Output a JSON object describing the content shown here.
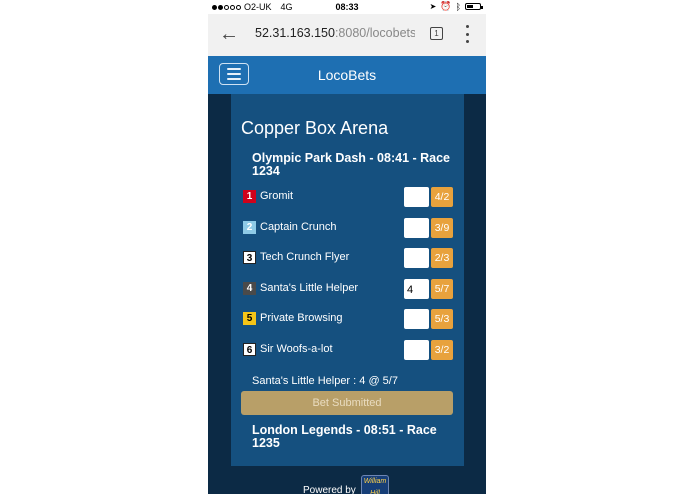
{
  "status_bar": {
    "carrier": "O2-UK",
    "network": "4G",
    "time": "08:33"
  },
  "browser": {
    "url_host": "52.31.163.150",
    "url_rest": ":8080/locobets",
    "tab_count": "1"
  },
  "navbar": {
    "brand": "LocoBets"
  },
  "venue": "Copper Box Arena",
  "races": [
    {
      "title": "Olympic Park Dash - 08:41 - Race 1234",
      "runners": [
        {
          "number": "1",
          "name": "Gromit",
          "stake": "",
          "odds": "4/2",
          "badge_bg": "#d0021b",
          "badge_fg": "#ffffff"
        },
        {
          "number": "2",
          "name": "Captain Crunch",
          "stake": "",
          "odds": "3/9",
          "badge_bg": "#8ecae6",
          "badge_fg": "#ffffff"
        },
        {
          "number": "3",
          "name": "Tech Crunch Flyer",
          "stake": "",
          "odds": "2/3",
          "badge_bg": "#ffffff",
          "badge_fg": "#000000"
        },
        {
          "number": "4",
          "name": "Santa's Little Helper",
          "stake": "4",
          "odds": "5/7",
          "badge_bg": "#4a4a4a",
          "badge_fg": "#ffffff"
        },
        {
          "number": "5",
          "name": "Private Browsing",
          "stake": "",
          "odds": "5/3",
          "badge_bg": "#f5c518",
          "badge_fg": "#000000"
        },
        {
          "number": "6",
          "name": "Sir Woofs-a-lot",
          "stake": "",
          "odds": "3/2",
          "badge_bg": "#ffffff",
          "badge_fg": "#000000"
        }
      ]
    },
    {
      "title": "London Legends - 08:51 - Race 1235"
    }
  ],
  "bet_summary": "Santa's Little Helper : 4 @ 5/7",
  "submit_label": "Bet Submitted",
  "footer": {
    "powered_by": "Powered by",
    "logo_text": "William Hill"
  },
  "colors": {
    "navbar": "#1e6fb2",
    "background": "#0c2a45",
    "panel": "#15507f",
    "odds": "#e8a23d",
    "submit": "#b89f68"
  }
}
